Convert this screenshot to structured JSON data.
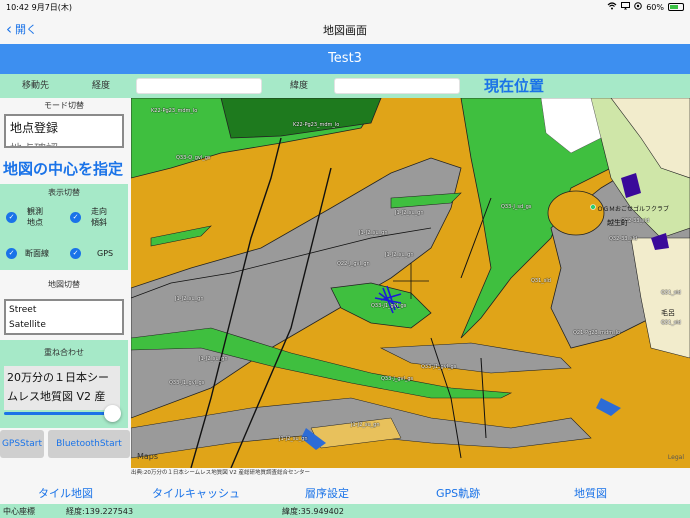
{
  "statusbar": {
    "time": "10:42",
    "date": "9月7日(木)",
    "battery": "60%"
  },
  "nav": {
    "back_label": "開く",
    "title": "地図画面"
  },
  "project": {
    "name": "Test3"
  },
  "coords": {
    "move_label": "移動先",
    "lon_label": "経度",
    "lat_label": "緯度",
    "lon_value": "",
    "lat_value": "",
    "current_button": "現在位置"
  },
  "left": {
    "mode_title": "モード切替",
    "mode_items": [
      "地点登録",
      "地点確認"
    ],
    "center_button": "地図の中心を指定",
    "display_title": "表示切替",
    "toggles": [
      {
        "label1": "観測",
        "label2": "地点"
      },
      {
        "label1": "走向",
        "label2": "傾斜"
      },
      {
        "label1": "断面線",
        "label2": ""
      },
      {
        "label1": "GPS",
        "label2": ""
      }
    ],
    "map_switch_title": "地図切替",
    "map_types": [
      "Street",
      "Satellite"
    ],
    "overlay_title": "重ね合わせ",
    "overlay_value": "20万分の１日本シームレス地質図 V2 産",
    "overlay_slider": 1.0,
    "gps_start": "GPSStart",
    "bluetooth_start": "BluetoothStart"
  },
  "map": {
    "labels": [
      "K22-Pg23_mdm_lo",
      "K22-Pg23_mdm_lo",
      "Q33-Q_gvl_gs",
      "J1-J2_su_gn",
      "J1-J2_su_gn",
      "J1-J2_su_gn",
      "Q33-J_sd_gs",
      "Q32-33_sld",
      "Q32-33_sld",
      "J1-J2_su_gn",
      "J1-J2_su_gn",
      "Q22-J_gvl_gn",
      "Q33-J1_gvl_gs",
      "Q33-J1_gvl_gs",
      "Q21-Pg23_mdm_lo",
      "J1-J2_su_gn",
      "Q33-J_gvl_gs",
      "Q33-J1_gvl_gs",
      "J1-J2_su_gn",
      "Q31_sld",
      "Q31_sld",
      "Q31_sld"
    ],
    "towns": [
      "越生町",
      "毛呂",
      "ＯＧＭおごせゴルフクラブ"
    ],
    "maps_logo": "Maps",
    "legal": "Legal"
  },
  "attribution": "出典:20万分の１日本シームレス地質図 V2 産総研地質調査総合センター",
  "tabs": [
    "タイル地図",
    "タイルキャッシュ",
    "層序設定",
    "GPS軌跡",
    "地質図"
  ],
  "footer": {
    "center_label": "中心座標",
    "lon": "経度:139.227543",
    "lat": "緯度:35.949402"
  },
  "colors": {
    "accent": "#1a73e8",
    "project_bar": "#3d8ff0",
    "panel_green": "#a6e9c8",
    "geo_orange": "#e0a418",
    "geo_gray": "#9a9a9a",
    "geo_green": "#3fbf3f"
  }
}
